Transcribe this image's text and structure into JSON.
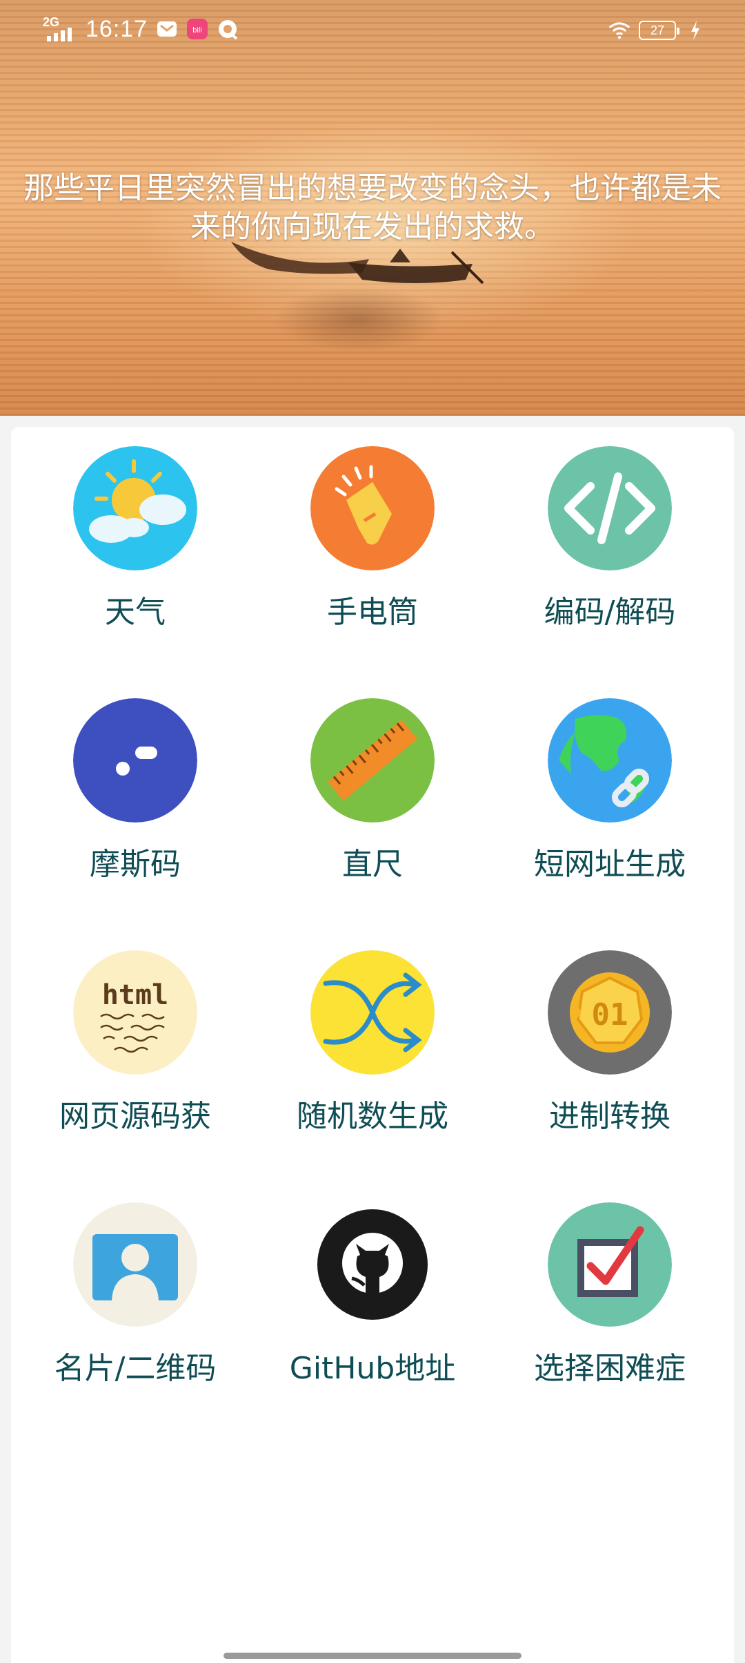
{
  "status_bar": {
    "network": "2G",
    "time": "16:17",
    "battery": "27",
    "icons": [
      "signal-icon",
      "mail-icon",
      "app-icon",
      "assistant-icon",
      "wifi-icon",
      "battery-icon",
      "charging-icon"
    ]
  },
  "header": {
    "quote": "那些平日里突然冒出的想要改变的念头，也许都是未来的你向现在发出的求救。",
    "background": "sunset-boats-photo"
  },
  "tools": [
    {
      "label": "天气",
      "icon": "weather-icon",
      "color": "#2cc4ef"
    },
    {
      "label": "手电筒",
      "icon": "flashlight-icon",
      "color": "#f57c33"
    },
    {
      "label": "编码/解码",
      "icon": "code-icon",
      "color": "#6cc3a8"
    },
    {
      "label": "摩斯码",
      "icon": "morse-icon",
      "color": "#3e4fbf"
    },
    {
      "label": "直尺",
      "icon": "ruler-icon",
      "color": "#7bc043"
    },
    {
      "label": "短网址生成",
      "icon": "globe-link-icon",
      "color": "#3aa5ee"
    },
    {
      "label": "网页源码获",
      "icon": "html-icon",
      "color": "#fcefc4"
    },
    {
      "label": "随机数生成",
      "icon": "shuffle-icon",
      "color": "#fbe235"
    },
    {
      "label": "进制转换",
      "icon": "binary-coin-icon",
      "color": "#6e6e6e"
    },
    {
      "label": "名片/二维码",
      "icon": "contact-card-icon",
      "color": "#f3efe3"
    },
    {
      "label": "GitHub地址",
      "icon": "github-icon",
      "color": "#1a1a1a"
    },
    {
      "label": "选择困难症",
      "icon": "checkbox-icon",
      "color": "#6cc3a8"
    }
  ]
}
